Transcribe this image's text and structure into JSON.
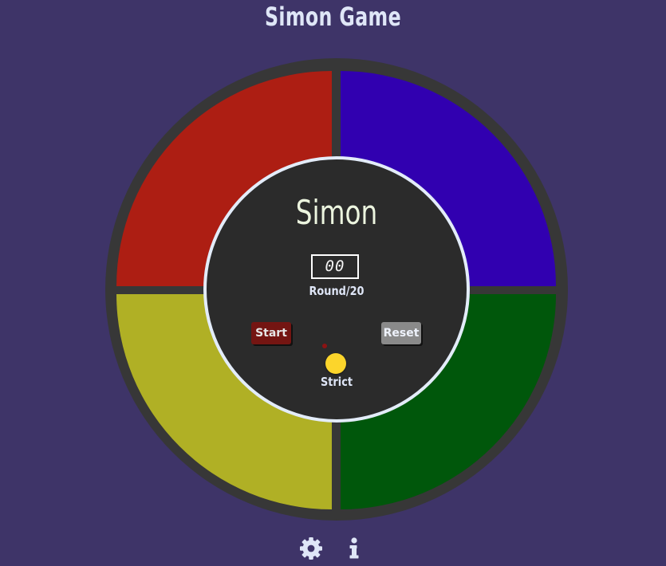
{
  "page": {
    "title": "Simon Game",
    "background_color": "#3e3468"
  },
  "board": {
    "brand": "Simon",
    "round_counter": "00",
    "round_label": "Round/20",
    "colors": {
      "red": "#ad1e13",
      "blue": "#3100b0",
      "yellow": "#b0b025",
      "green": "#00570b",
      "rim": "#373737",
      "center": "#2b2b2b"
    }
  },
  "controls": {
    "start_label": "Start",
    "reset_label": "Reset",
    "strict_label": "Strict"
  },
  "footer": {
    "icons": [
      "gear-icon",
      "info-icon"
    ]
  }
}
